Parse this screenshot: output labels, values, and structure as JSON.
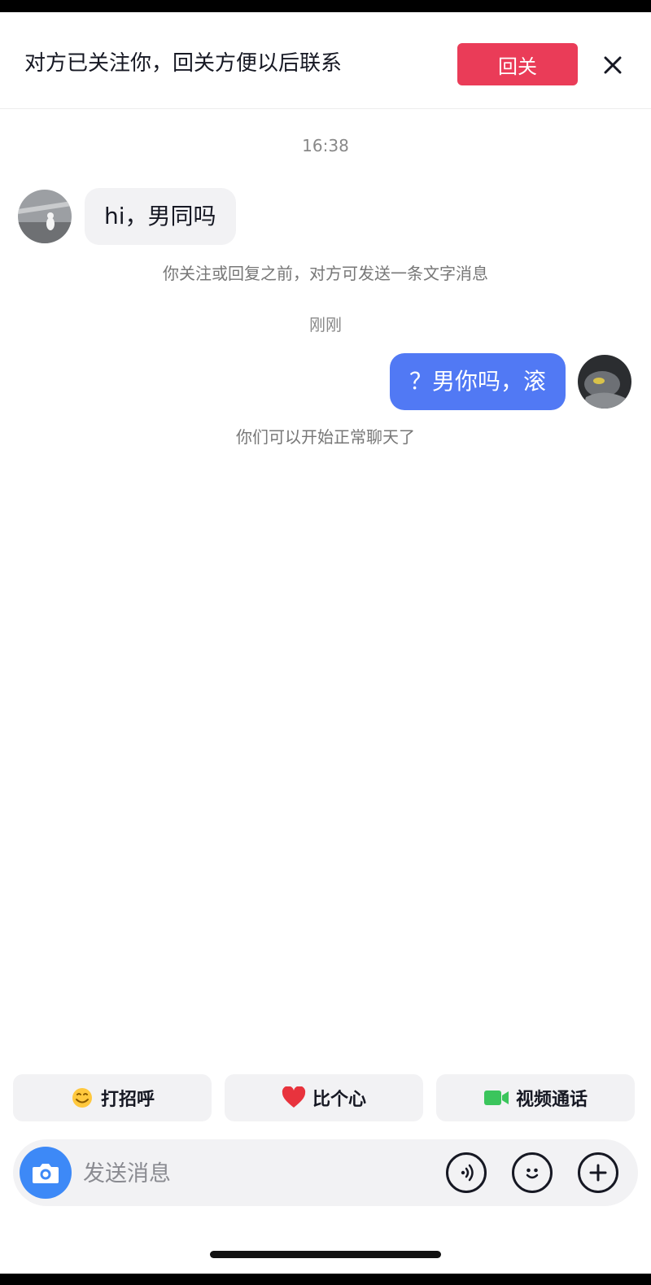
{
  "follow_banner": {
    "text": "对方已关注你，回关方便以后联系",
    "button_label": "回关"
  },
  "messages": [
    {
      "timestamp": "16:38",
      "direction": "incoming",
      "text": "hi，男同吗"
    },
    {
      "system_note": "你关注或回复之前，对方可发送一条文字消息"
    },
    {
      "timestamp": "刚刚",
      "direction": "outgoing",
      "text": "？男你吗，滚"
    },
    {
      "system_note": "你们可以开始正常聊天了"
    }
  ],
  "quick_actions": [
    {
      "label": "打招呼",
      "icon": "waving-hand-emoji"
    },
    {
      "label": "比个心",
      "icon": "red-heart-emoji"
    },
    {
      "label": "视频通话",
      "icon": "video-camera-icon"
    }
  ],
  "composer": {
    "placeholder": "发送消息",
    "icons": [
      "camera-icon",
      "voice-icon",
      "emoji-face-icon",
      "plus-icon"
    ]
  },
  "colors": {
    "follow_button": "#ea3c58",
    "outgoing_bubble": "#5179f4",
    "incoming_bubble": "#f2f2f4",
    "camera_button": "#3d89f7"
  }
}
